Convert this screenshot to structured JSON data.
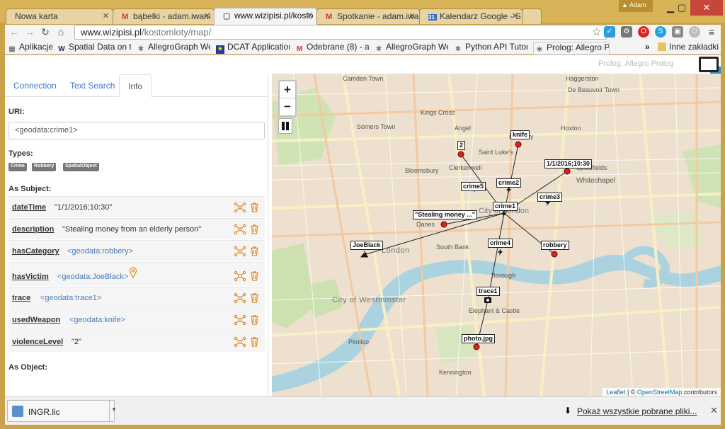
{
  "browser": {
    "tabs": [
      {
        "label": "Nowa karta",
        "icon": "blank-page-icon"
      },
      {
        "label": "bąbelki - adam.iwani",
        "icon": "gmail-icon"
      },
      {
        "label": "www.wizipisi.pl/kosto",
        "icon": "page-icon"
      },
      {
        "label": "Spotkanie - adam.iwa",
        "icon": "gmail-icon"
      },
      {
        "label": "Kalendarz Google - S",
        "icon": "calendar-icon"
      }
    ],
    "profile_name": "Adam",
    "url_host": "www.wizipisi.pl",
    "url_path": "/kostomloty/map/",
    "bookmarks": [
      {
        "label": "Aplikacje"
      },
      {
        "label": "Spatial Data on th"
      },
      {
        "label": "AllegroGraph We"
      },
      {
        "label": "DCAT Application"
      },
      {
        "label": "Odebrane (8) - ad"
      },
      {
        "label": "AllegroGraph We"
      },
      {
        "label": "Python API Tutor"
      },
      {
        "label": "Prolog: Allegro Pr"
      }
    ],
    "bookmarks_more": "»",
    "other_bookmarks": "Inne zakładki"
  },
  "header": {
    "logo_text": "Prolog: Allegro Prolog"
  },
  "panel": {
    "tabs": [
      "Connection",
      "Text Search",
      "Info"
    ],
    "uri_label": "URI:",
    "uri_value": "<geodata:crime1>",
    "types_label": "Types:",
    "types": [
      "Crime",
      "Robbery",
      "SpatialObject"
    ],
    "as_subject_label": "As Subject:",
    "properties": [
      {
        "name": "dateTime",
        "value": "\"1/1/2016;10:30\""
      },
      {
        "name": "description",
        "value": "\"Stealing money from an elderly person\""
      },
      {
        "name": "hasCategory",
        "value": "<geodata:robbery>"
      },
      {
        "name": "hasVictim",
        "value": "<geodata:JoeBlack>"
      },
      {
        "name": "trace",
        "value": "<geodata:trace1>"
      },
      {
        "name": "usedWeapon",
        "value": "<geodata:knife>"
      },
      {
        "name": "violenceLevel",
        "value": "\"2\""
      }
    ],
    "as_object_label": "As Object:"
  },
  "map": {
    "zoom_in": "+",
    "zoom_out": "−",
    "labels": {
      "knife": "knife",
      "two": "2",
      "datetime": "1/1/2016;10:30",
      "crime5": "crime5",
      "crime2": "crime2",
      "crime3": "crime3",
      "crime1": "crime1",
      "stealing": "\"Stealing money ...\"",
      "joeblack": "JoeBlack",
      "crime4": "crime4",
      "robbery": "robbery",
      "trace1": "trace1",
      "photo": "photo.jpg"
    },
    "places": {
      "camden": "Camden Town",
      "angel": "Angel",
      "finsbury": "Finsbury",
      "bloomsbury": "Bloomsbury",
      "clerkenwell": "Clerkenwell",
      "stlukes": "Saint Luke's",
      "whitechapel": "Whitechapel",
      "spitalfields": "Spitalfields",
      "london": "London",
      "cityoflondon": "City of London",
      "southbank": "South Bank",
      "danes": "Danes",
      "westminster": "City of Westminster",
      "borough": "Borough",
      "elephant": "Elephant & Castle",
      "pimlico": "Pimlico",
      "kennington": "Kennington",
      "hoxton": "Hoxton",
      "haggerston": "Haggerston",
      "debeauvoir": "De Beauvoir Town",
      "kingscross": "Kings Cross",
      "somers": "Somers Town"
    },
    "attribution_leaflet": "Leaflet",
    "attribution_sep": " | © ",
    "attribution_osm": "OpenStreetMap",
    "attribution_rest": " contributors"
  },
  "downloads": {
    "file_name": "INGR.lic",
    "show_all": "Pokaż wszystkie pobrane pliki...",
    "close": "✕"
  }
}
